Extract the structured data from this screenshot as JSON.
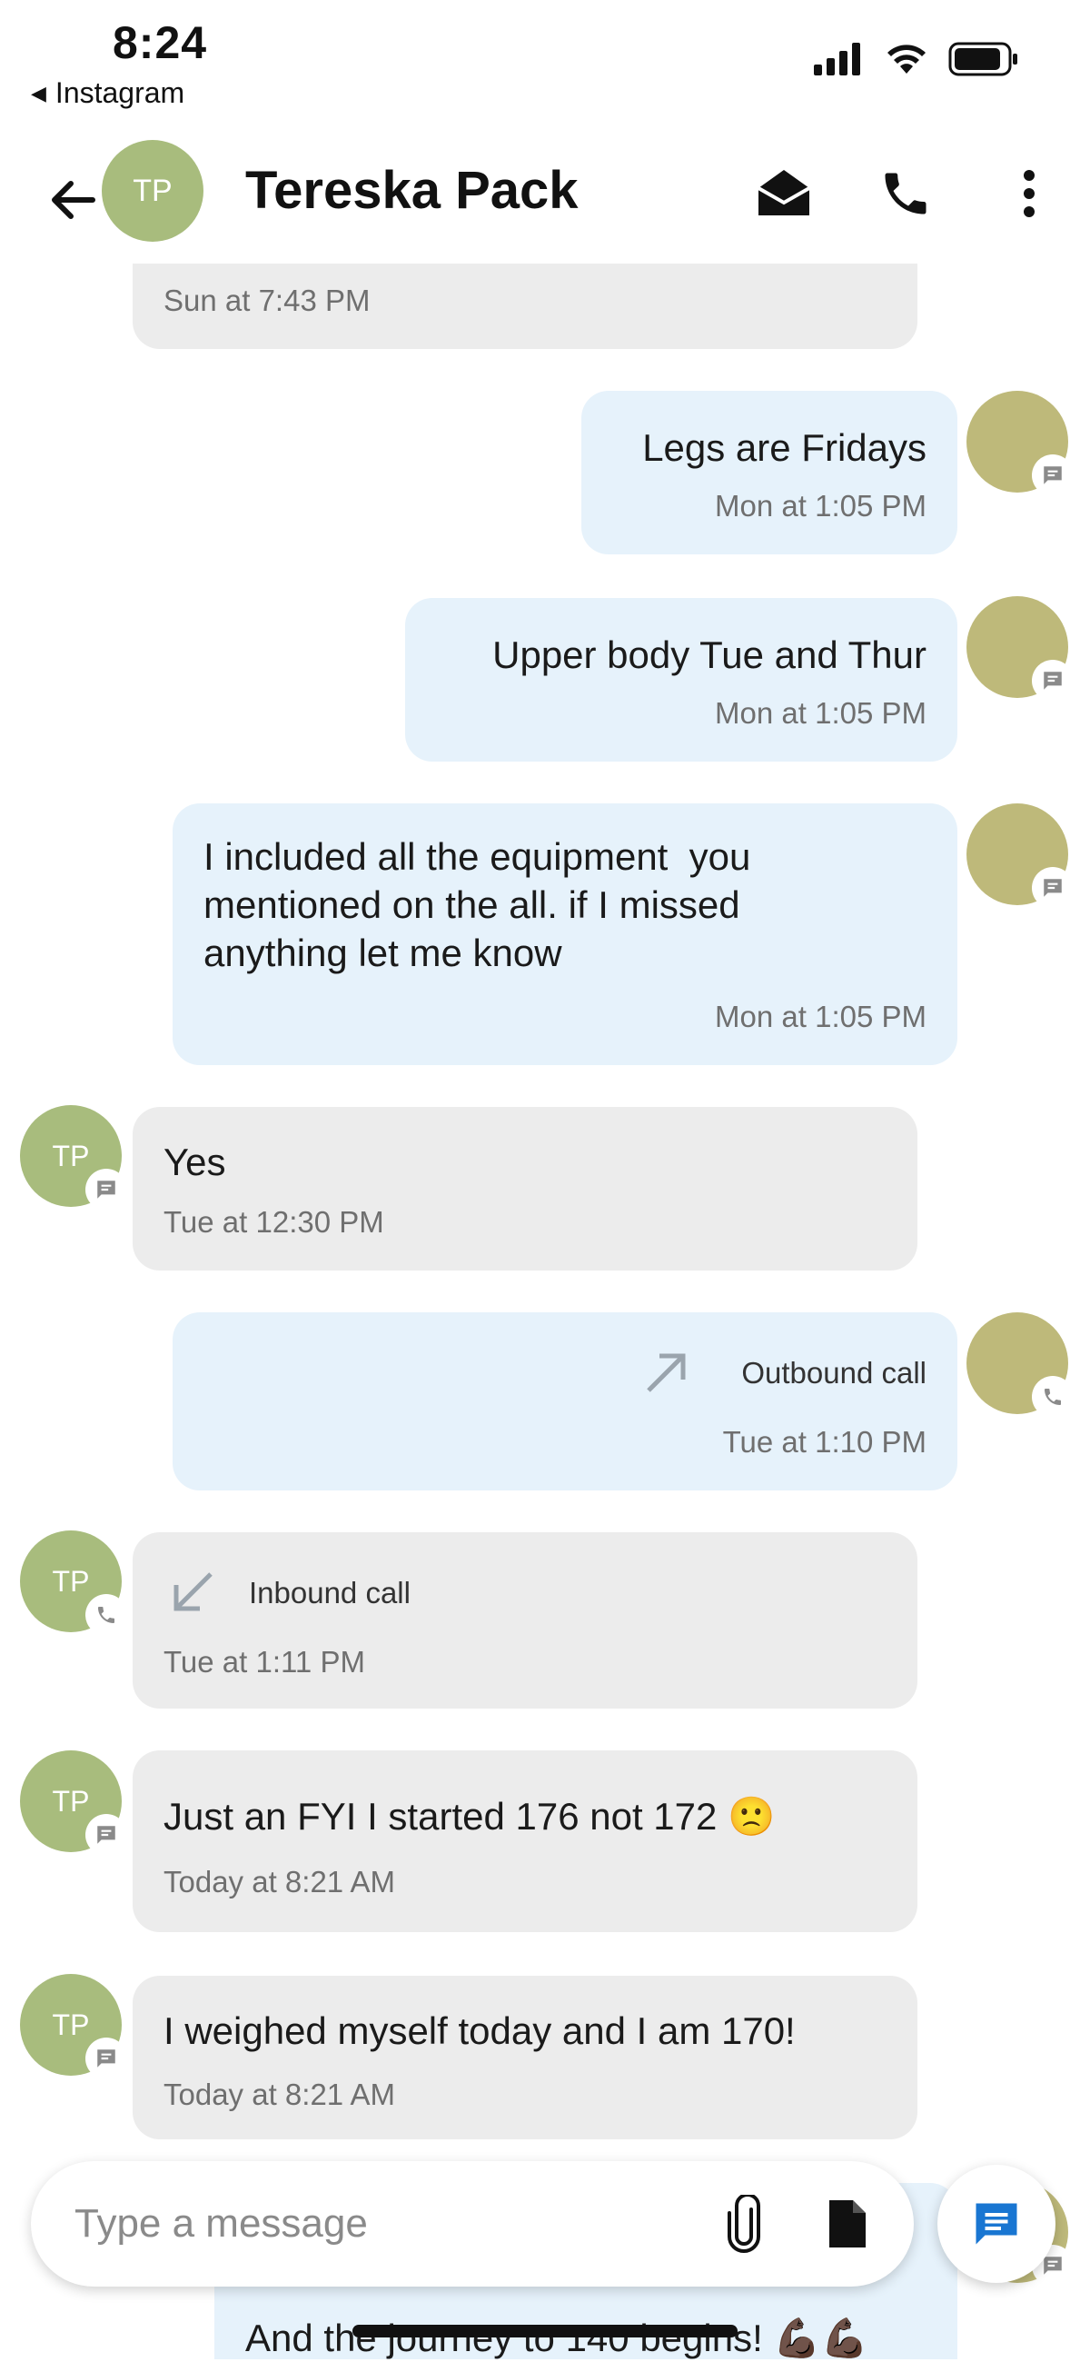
{
  "status_bar": {
    "time": "8:24",
    "back_app": "Instagram",
    "icons": [
      "signal-icon",
      "wifi-icon",
      "battery-icon"
    ]
  },
  "header": {
    "avatar_initials": "TP",
    "contact_name": "Tereska Pack",
    "actions": [
      "mail-open-icon",
      "phone-icon",
      "more-vert-icon"
    ]
  },
  "colors": {
    "contact_avatar": "#a8bc7d",
    "self_avatar": "#beb97a",
    "incoming_bubble": "#ececec",
    "outgoing_bubble": "#e6f2fb",
    "accent": "#1976d2"
  },
  "messages": [
    {
      "direction": "in",
      "text": "",
      "time": "Sun at 7:43 PM"
    },
    {
      "direction": "out",
      "text": "Legs are Fridays",
      "time": "Mon at 1:05 PM",
      "badge": "message-icon"
    },
    {
      "direction": "out",
      "text": "Upper body Tue and Thur",
      "time": "Mon at 1:05 PM",
      "badge": "message-icon"
    },
    {
      "direction": "out",
      "text": "I included all the equipment  you\nmentioned on the all. if I missed\nanything let me know",
      "time": "Mon at 1:05 PM",
      "badge": "message-icon"
    },
    {
      "direction": "in",
      "avatar": "TP",
      "text": "Yes",
      "time": "Tue at 12:30 PM",
      "badge": "message-icon"
    },
    {
      "direction": "out",
      "call": "Outbound call",
      "time": "Tue at 1:10 PM",
      "badge": "phone-icon"
    },
    {
      "direction": "in",
      "avatar": "TP",
      "call": "Inbound call",
      "time": "Tue at 1:11 PM",
      "badge": "phone-icon"
    },
    {
      "direction": "in",
      "avatar": "TP",
      "text": "Just an FYI I started 176 not 172 🙁",
      "time": "Today at 8:21 AM",
      "badge": "message-icon"
    },
    {
      "direction": "in",
      "avatar": "TP",
      "text": "I weighed myself today and I am 170!",
      "time": "Today at 8:21 AM",
      "badge": "message-icon"
    },
    {
      "direction": "out",
      "text": "And the journey to 140 begins! 💪🏿💪🏿",
      "time": "",
      "badge": "message-icon"
    }
  ],
  "composer": {
    "placeholder": "Type a message",
    "attach_icon": "paperclip-icon",
    "file_icon": "document-icon",
    "fab_icon": "message-icon"
  }
}
